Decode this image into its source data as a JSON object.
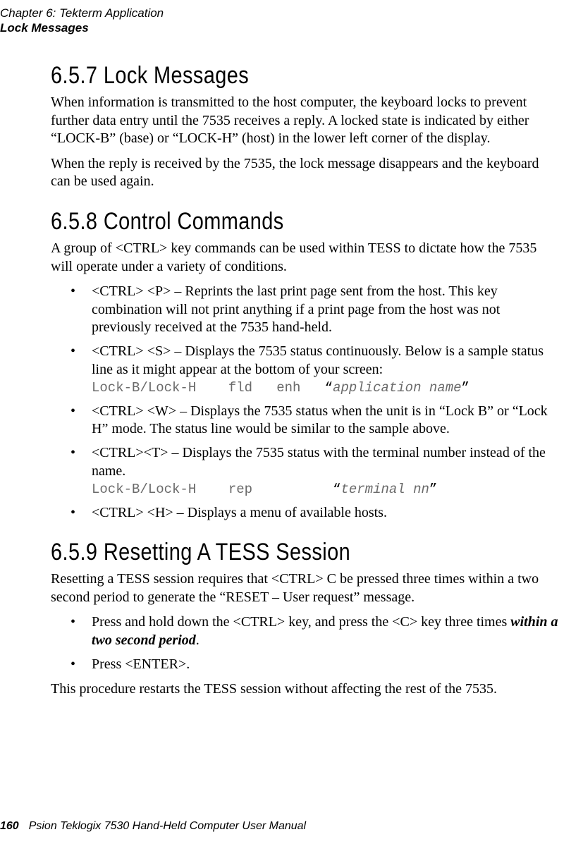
{
  "header": {
    "chapter": "Chapter 6: Tekterm Application",
    "topic": "Lock Messages"
  },
  "sections": {
    "s657": {
      "heading": "6.5.7  Lock Messages",
      "p1": "When information is transmitted to the host computer, the keyboard locks to prevent further data entry until the 7535 receives a reply. A locked state is indicated by either “LOCK-B” (base) or “LOCK-H” (host) in the lower left corner of the display.",
      "p2": "When the reply is received by the 7535, the lock message disappears and the keyboard can be used again."
    },
    "s658": {
      "heading": "6.5.8  Control Commands",
      "p1": "A group of <CTRL> key commands can be used within TESS to dictate how the 7535 will operate under a variety of conditions.",
      "b1": " <CTRL> <P>  – Reprints the last print page sent from the host. This key combination will not print anything if a print page from the host was not previously received at the 7535 hand-held.",
      "b2": "<CTRL> <S> – Displays the 7535 status continuously. Below is a sample status line as it might appear at the bottom of your screen:",
      "b2_code_prefix": "Lock-B/Lock-H    fld   enh   ",
      "b2_code_q1": "“",
      "b2_code_italic": "application name",
      "b2_code_q2": "”",
      "b3": "<CTRL> <W> – Displays the 7535 status when the unit is in “Lock B” or “Lock H” mode. The status line would be similar to the sample above.",
      "b4": "<CTRL><T> – Displays the 7535 status with the terminal number instead of the name.",
      "b4_code_prefix": "Lock-B/Lock-H    rep          ",
      "b4_code_q1": "“",
      "b4_code_italic": "terminal nn",
      "b4_code_q2": "”",
      "b5": "<CTRL> <H> – Displays a menu of available hosts."
    },
    "s659": {
      "heading": "6.5.9  Resetting A TESS Session",
      "p1": "Resetting a TESS session requires that <CTRL> C be pressed three times within a two second period to generate the “RESET – User request” message.",
      "b1_prefix": "Press and hold down the <CTRL> key, and press the <C> key three times ",
      "b1_em": "within a two second period",
      "b1_suffix": ".",
      "b2": "Press <ENTER>.",
      "p2": "This procedure restarts the TESS session without affecting the rest of the 7535."
    }
  },
  "footer": {
    "page": "160",
    "title": "Psion Teklogix 7530 Hand-Held Computer User Manual"
  }
}
